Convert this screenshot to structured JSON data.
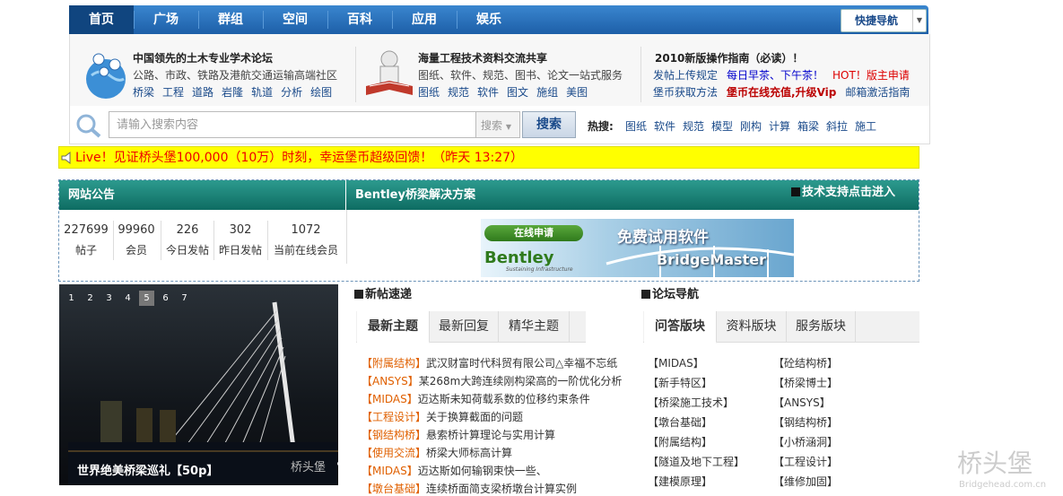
{
  "nav": {
    "items": [
      "首页",
      "广场",
      "群组",
      "空间",
      "百科",
      "应用",
      "娱乐"
    ],
    "quick_nav": "快捷导航"
  },
  "info": {
    "col1": {
      "title": "中国领先的土木专业学术论坛",
      "line1": "公路、市政、铁路及港航交通运输高端社区",
      "links": [
        "桥梁",
        "工程",
        "道路",
        "岩隆",
        "轨道",
        "分析",
        "绘图"
      ]
    },
    "col2": {
      "title": "海量工程技术资料交流共享",
      "line1": "图纸、软件、规范、图书、论文一站式服务",
      "links": [
        "图纸",
        "规范",
        "软件",
        "图文",
        "施组",
        "美图"
      ]
    },
    "col3": {
      "title": "2010新版操作指南（必读）！",
      "row1": [
        "发帖上传规定",
        "每日早茶、下午茶！",
        "HOT！版主申请"
      ],
      "row2": [
        "堡币获取方法",
        "堡币在线充值,升级Vip",
        "邮箱激活指南"
      ]
    }
  },
  "search": {
    "placeholder": "请输入搜索内容",
    "select": "搜索",
    "button": "搜索",
    "hot_label": "热搜:",
    "hot": [
      "图纸",
      "软件",
      "规范",
      "模型",
      "刚构",
      "计算",
      "箱梁",
      "斜拉",
      "施工"
    ]
  },
  "live": "Live！见证桥头堡100,000（10万）时刻，幸运堡币超级回馈！（昨天 13:27）",
  "board": {
    "notice_title": "网站公告",
    "solution_title": "Bentley桥梁解决方案",
    "support_link": "技术支持点击进入",
    "stats": [
      {
        "n": "227699",
        "l": "帖子"
      },
      {
        "n": "99960",
        "l": "会员"
      },
      {
        "n": "226",
        "l": "今日发帖"
      },
      {
        "n": "302",
        "l": "昨日发帖"
      },
      {
        "n": "1072",
        "l": "当前在线会员"
      }
    ],
    "banner": {
      "apply": "在线申请",
      "free": "免费试用软件",
      "brand": "Bentley",
      "tagline": "Sustaining Infrastructure",
      "product": "BridgeMaster"
    }
  },
  "slideshow": {
    "numbers": [
      "1",
      "2",
      "3",
      "4",
      "5",
      "6",
      "7"
    ],
    "active": "5",
    "caption": "世界绝美桥梁巡礼【50p】",
    "watermark": "桥头堡"
  },
  "posts": {
    "heading": "新帖速递",
    "tabs": [
      "最新主题",
      "最新回复",
      "精华主题"
    ],
    "items": [
      {
        "tag": "【附属结构】",
        "title": "武汉财富时代科贸有限公司△幸福不忘纸"
      },
      {
        "tag": "【ANSYS】",
        "title": "某268m大跨连续刚构梁高的一阶优化分析"
      },
      {
        "tag": "【MIDAS】",
        "title": "迈达斯未知荷载系数的位移约束条件"
      },
      {
        "tag": "【工程设计】",
        "title": "关于换算截面的问题"
      },
      {
        "tag": "【钢结构桥】",
        "title": "悬索桥计算理论与实用计算"
      },
      {
        "tag": "【使用交流】",
        "title": "桥梁大师标高计算"
      },
      {
        "tag": "【MIDAS】",
        "title": "迈达斯如何输钢束快一些、"
      },
      {
        "tag": "【墩台基础】",
        "title": "连续桥面简支梁桥墩台计算实例"
      }
    ]
  },
  "forum": {
    "heading": "论坛导航",
    "tabs": [
      "问答版块",
      "资料版块",
      "服务版块"
    ],
    "col1": [
      "【MIDAS】",
      "【新手特区】",
      "【桥梁施工技术】",
      "【墩台基础】",
      "【附属结构】",
      "【隧道及地下工程】",
      "【建模原理】"
    ],
    "col2": [
      "【砼结构桥】",
      "【桥梁博士】",
      "【ANSYS】",
      "【钢结构桥】",
      "【小桥涵洞】",
      "【工程设计】",
      "【维修加固】"
    ]
  },
  "watermark": {
    "name": "桥头堡",
    "url": "Bridgehead.com.cn"
  }
}
